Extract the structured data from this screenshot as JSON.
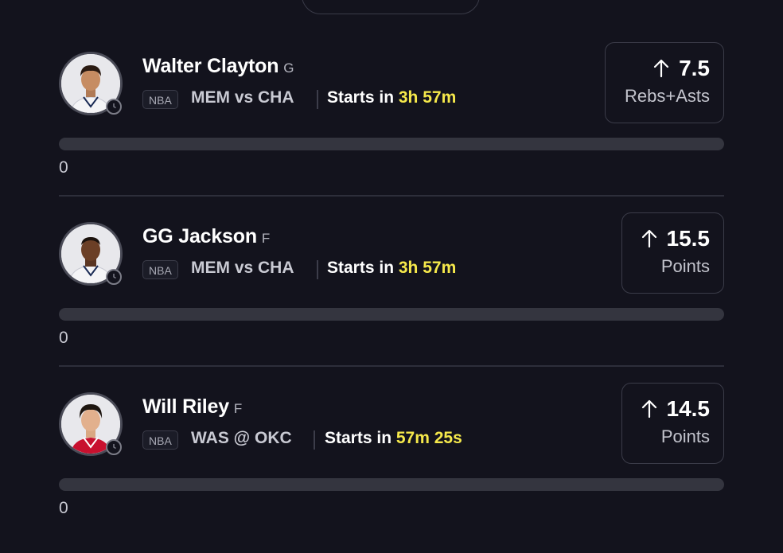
{
  "players": [
    {
      "name": "Walter Clayton",
      "position": "G",
      "league": "NBA",
      "matchup": "MEM vs CHA",
      "starts_prefix": "Starts in",
      "countdown": "3h 57m",
      "line_value": "7.5",
      "stat": "Rebs+Asts",
      "direction_icon": "arrow-up-icon",
      "progress_value": "0",
      "progress_fraction": 0,
      "jersey_color": "#f4f4f6"
    },
    {
      "name": "GG Jackson",
      "position": "F",
      "league": "NBA",
      "matchup": "MEM vs CHA",
      "starts_prefix": "Starts in",
      "countdown": "3h 57m",
      "line_value": "15.5",
      "stat": "Points",
      "direction_icon": "arrow-up-icon",
      "progress_value": "0",
      "progress_fraction": 0,
      "jersey_color": "#f4f4f6"
    },
    {
      "name": "Will Riley",
      "position": "F",
      "league": "NBA",
      "matchup": "WAS @ OKC",
      "starts_prefix": "Starts in",
      "countdown": "57m 25s",
      "line_value": "14.5",
      "stat": "Points",
      "direction_icon": "arrow-up-icon",
      "progress_value": "0",
      "progress_fraction": 0,
      "jersey_color": "#c8102e"
    }
  ],
  "colors": {
    "background": "#13131d",
    "countdown": "#f6e94b",
    "progress_track": "#34353f",
    "border": "#3b3c49"
  }
}
